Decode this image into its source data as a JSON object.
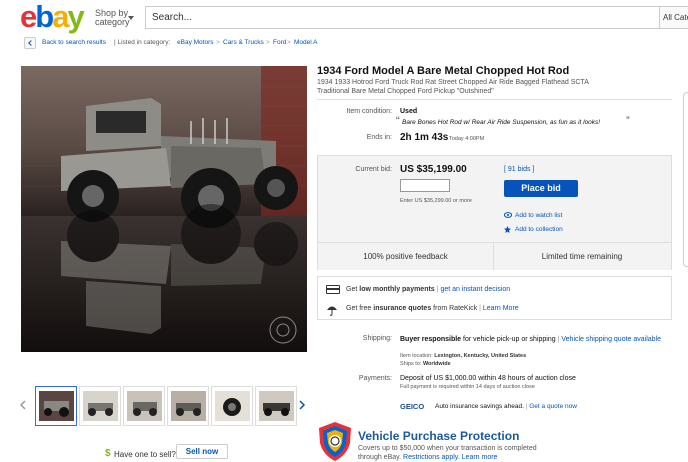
{
  "header": {
    "logo_letters": [
      "e",
      "b",
      "a",
      "y"
    ],
    "logo_colors": [
      "#e53238",
      "#0064d2",
      "#f5af02",
      "#86b817"
    ],
    "shop_by_line1": "Shop by",
    "shop_by_line2": "category",
    "search_placeholder": "Search...",
    "search_category": "All Cate"
  },
  "breadcrumb": {
    "back_label": "Back to search results",
    "listed_in": "| Listed in category:",
    "crumbs": [
      "eBay Motors",
      "Cars & Trucks",
      "Ford",
      "Model A"
    ],
    "separator": ">"
  },
  "listing": {
    "title": "1934 Ford Model A Bare Metal Chopped Hot Rod",
    "subtitle": "1934 1933 Hotrod Ford Truck Rod Rat Street Chopped Air Ride Bagged Flathead SCTA Traditional Bare Metal Chopped Ford Pickup \"Outshined\"",
    "condition_label": "Item condition:",
    "condition_value": "Used",
    "condition_quote": "Bare Bones Hot Rod w/ Rear Air Ride Suspension, as fun as it looks!",
    "ends_label": "Ends in:",
    "ends_value": "2h 1m 43s",
    "ends_time": "Today 4:00PM"
  },
  "bid": {
    "current_label": "Current bid:",
    "current_value": "US $35,199.00",
    "bids_link": "[ 91 bids ]",
    "input_hint": "Enter US $35,299.00 or more",
    "place_bid": "Place bid",
    "watch": "Add to watch list",
    "collection": "Add to collection",
    "feedback": "100% positive feedback",
    "limited": "Limited time remaining"
  },
  "finance": {
    "line1_prefix": "Get",
    "line1_bold": "low monthly payments",
    "line1_link": "get an instant decision",
    "line2_prefix": "Get free",
    "line2_bold": "insurance quotes",
    "line2_from": "from RateKick",
    "line2_link": "Learn More"
  },
  "shipping": {
    "label": "Shipping:",
    "buyer_bold": "Buyer responsible",
    "buyer_rest": "for vehicle pick-up or shipping",
    "link": "Vehicle shipping quote available",
    "location_label": "Item location:",
    "location_value": "Lexington, Kentucky, United States",
    "ships_label": "Ships to:",
    "ships_value": "Worldwide"
  },
  "payments": {
    "label": "Payments:",
    "line1": "Deposit of US $1,000.00 within 48 hours of auction close",
    "line2": "Full payment is required within 14 days of auction close",
    "geico": "GEICO",
    "geico_text": "Auto insurance savings ahead.",
    "geico_link": "Get a quote now"
  },
  "protection": {
    "title": "Vehicle Purchase Protection",
    "text": "Covers up to $50,000 when your transaction is completed through eBay.",
    "restrictions": "Restrictions apply.",
    "learn": "Learn more"
  },
  "sell": {
    "prompt": "Have one to sell?",
    "button": "Sell now"
  }
}
